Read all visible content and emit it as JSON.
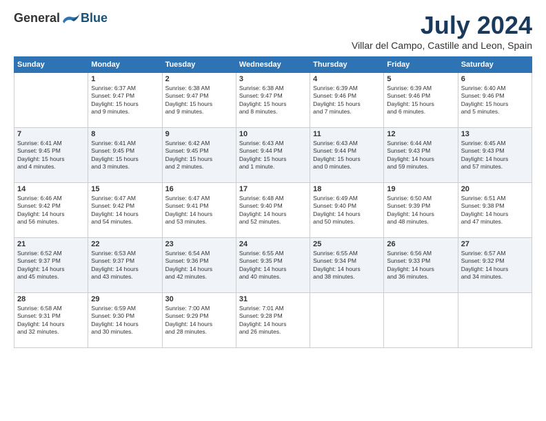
{
  "header": {
    "logo_general": "General",
    "logo_blue": "Blue",
    "month_title": "July 2024",
    "location": "Villar del Campo, Castille and Leon, Spain"
  },
  "weekdays": [
    "Sunday",
    "Monday",
    "Tuesday",
    "Wednesday",
    "Thursday",
    "Friday",
    "Saturday"
  ],
  "weeks": [
    [
      {
        "day": "",
        "info": ""
      },
      {
        "day": "1",
        "info": "Sunrise: 6:37 AM\nSunset: 9:47 PM\nDaylight: 15 hours\nand 9 minutes."
      },
      {
        "day": "2",
        "info": "Sunrise: 6:38 AM\nSunset: 9:47 PM\nDaylight: 15 hours\nand 9 minutes."
      },
      {
        "day": "3",
        "info": "Sunrise: 6:38 AM\nSunset: 9:47 PM\nDaylight: 15 hours\nand 8 minutes."
      },
      {
        "day": "4",
        "info": "Sunrise: 6:39 AM\nSunset: 9:46 PM\nDaylight: 15 hours\nand 7 minutes."
      },
      {
        "day": "5",
        "info": "Sunrise: 6:39 AM\nSunset: 9:46 PM\nDaylight: 15 hours\nand 6 minutes."
      },
      {
        "day": "6",
        "info": "Sunrise: 6:40 AM\nSunset: 9:46 PM\nDaylight: 15 hours\nand 5 minutes."
      }
    ],
    [
      {
        "day": "7",
        "info": "Sunrise: 6:41 AM\nSunset: 9:45 PM\nDaylight: 15 hours\nand 4 minutes."
      },
      {
        "day": "8",
        "info": "Sunrise: 6:41 AM\nSunset: 9:45 PM\nDaylight: 15 hours\nand 3 minutes."
      },
      {
        "day": "9",
        "info": "Sunrise: 6:42 AM\nSunset: 9:45 PM\nDaylight: 15 hours\nand 2 minutes."
      },
      {
        "day": "10",
        "info": "Sunrise: 6:43 AM\nSunset: 9:44 PM\nDaylight: 15 hours\nand 1 minute."
      },
      {
        "day": "11",
        "info": "Sunrise: 6:43 AM\nSunset: 9:44 PM\nDaylight: 15 hours\nand 0 minutes."
      },
      {
        "day": "12",
        "info": "Sunrise: 6:44 AM\nSunset: 9:43 PM\nDaylight: 14 hours\nand 59 minutes."
      },
      {
        "day": "13",
        "info": "Sunrise: 6:45 AM\nSunset: 9:43 PM\nDaylight: 14 hours\nand 57 minutes."
      }
    ],
    [
      {
        "day": "14",
        "info": "Sunrise: 6:46 AM\nSunset: 9:42 PM\nDaylight: 14 hours\nand 56 minutes."
      },
      {
        "day": "15",
        "info": "Sunrise: 6:47 AM\nSunset: 9:42 PM\nDaylight: 14 hours\nand 54 minutes."
      },
      {
        "day": "16",
        "info": "Sunrise: 6:47 AM\nSunset: 9:41 PM\nDaylight: 14 hours\nand 53 minutes."
      },
      {
        "day": "17",
        "info": "Sunrise: 6:48 AM\nSunset: 9:40 PM\nDaylight: 14 hours\nand 52 minutes."
      },
      {
        "day": "18",
        "info": "Sunrise: 6:49 AM\nSunset: 9:40 PM\nDaylight: 14 hours\nand 50 minutes."
      },
      {
        "day": "19",
        "info": "Sunrise: 6:50 AM\nSunset: 9:39 PM\nDaylight: 14 hours\nand 48 minutes."
      },
      {
        "day": "20",
        "info": "Sunrise: 6:51 AM\nSunset: 9:38 PM\nDaylight: 14 hours\nand 47 minutes."
      }
    ],
    [
      {
        "day": "21",
        "info": "Sunrise: 6:52 AM\nSunset: 9:37 PM\nDaylight: 14 hours\nand 45 minutes."
      },
      {
        "day": "22",
        "info": "Sunrise: 6:53 AM\nSunset: 9:37 PM\nDaylight: 14 hours\nand 43 minutes."
      },
      {
        "day": "23",
        "info": "Sunrise: 6:54 AM\nSunset: 9:36 PM\nDaylight: 14 hours\nand 42 minutes."
      },
      {
        "day": "24",
        "info": "Sunrise: 6:55 AM\nSunset: 9:35 PM\nDaylight: 14 hours\nand 40 minutes."
      },
      {
        "day": "25",
        "info": "Sunrise: 6:55 AM\nSunset: 9:34 PM\nDaylight: 14 hours\nand 38 minutes."
      },
      {
        "day": "26",
        "info": "Sunrise: 6:56 AM\nSunset: 9:33 PM\nDaylight: 14 hours\nand 36 minutes."
      },
      {
        "day": "27",
        "info": "Sunrise: 6:57 AM\nSunset: 9:32 PM\nDaylight: 14 hours\nand 34 minutes."
      }
    ],
    [
      {
        "day": "28",
        "info": "Sunrise: 6:58 AM\nSunset: 9:31 PM\nDaylight: 14 hours\nand 32 minutes."
      },
      {
        "day": "29",
        "info": "Sunrise: 6:59 AM\nSunset: 9:30 PM\nDaylight: 14 hours\nand 30 minutes."
      },
      {
        "day": "30",
        "info": "Sunrise: 7:00 AM\nSunset: 9:29 PM\nDaylight: 14 hours\nand 28 minutes."
      },
      {
        "day": "31",
        "info": "Sunrise: 7:01 AM\nSunset: 9:28 PM\nDaylight: 14 hours\nand 26 minutes."
      },
      {
        "day": "",
        "info": ""
      },
      {
        "day": "",
        "info": ""
      },
      {
        "day": "",
        "info": ""
      }
    ]
  ]
}
